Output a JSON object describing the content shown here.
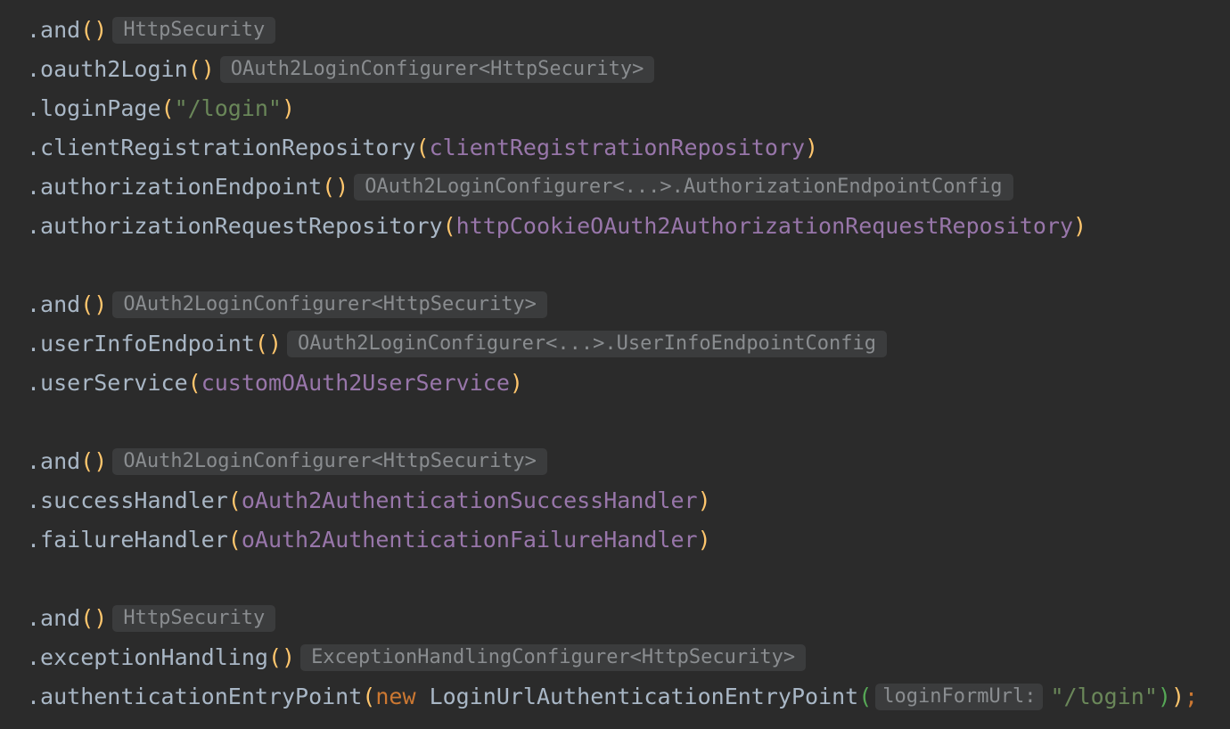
{
  "editor": {
    "lines": [
      {
        "method": ".and",
        "open": "(",
        "arg": "",
        "close": ")",
        "hint": "HttpSecurity"
      },
      {
        "method": ".oauth2Login",
        "open": "(",
        "arg": "",
        "close": ")",
        "hint": "OAuth2LoginConfigurer<HttpSecurity>"
      },
      {
        "method": ".loginPage",
        "open": "(",
        "arg": "\"/login\"",
        "close": ")"
      },
      {
        "method": ".clientRegistrationRepository",
        "open": "(",
        "arg": "clientRegistrationRepository",
        "close": ")"
      },
      {
        "method": ".authorizationEndpoint",
        "open": "(",
        "arg": "",
        "close": ")",
        "hint": "OAuth2LoginConfigurer<...>.AuthorizationEndpointConfig"
      },
      {
        "method": ".authorizationRequestRepository",
        "open": "(",
        "arg": "httpCookieOAuth2AuthorizationRequestRepository",
        "close": ")"
      },
      {
        "method": ".and",
        "open": "(",
        "arg": "",
        "close": ")",
        "hint": "OAuth2LoginConfigurer<HttpSecurity>"
      },
      {
        "method": ".userInfoEndpoint",
        "open": "(",
        "arg": "",
        "close": ")",
        "hint": "OAuth2LoginConfigurer<...>.UserInfoEndpointConfig"
      },
      {
        "method": ".userService",
        "open": "(",
        "arg": "customOAuth2UserService",
        "close": ")"
      },
      {
        "method": ".and",
        "open": "(",
        "arg": "",
        "close": ")",
        "hint": "OAuth2LoginConfigurer<HttpSecurity>"
      },
      {
        "method": ".successHandler",
        "open": "(",
        "arg": "oAuth2AuthenticationSuccessHandler",
        "close": ")"
      },
      {
        "method": ".failureHandler",
        "open": "(",
        "arg": "oAuth2AuthenticationFailureHandler",
        "close": ")"
      },
      {
        "method": ".and",
        "open": "(",
        "arg": "",
        "close": ")",
        "hint": "HttpSecurity"
      },
      {
        "method": ".exceptionHandling",
        "open": "(",
        "arg": "",
        "close": ")",
        "hint": "ExceptionHandlingConfigurer<HttpSecurity>"
      },
      {
        "method": ".authenticationEntryPoint",
        "open": "(",
        "keyword": "new",
        "class_name": "LoginUrlAuthenticationEntryPoint",
        "inner_open": "(",
        "param_hint": "loginFormUrl:",
        "arg": "\"/login\"",
        "inner_close": ")",
        "close": ")",
        "semicolon": ";"
      }
    ]
  },
  "colors": {
    "background": "#2b2b2b",
    "method": "#a9b7c6",
    "paren": "#ffc66d",
    "field": "#9876aa",
    "string": "#6a8759",
    "keyword": "#cc7832",
    "hint_bg": "#3b3c3d",
    "hint_text": "#8a8d90"
  }
}
